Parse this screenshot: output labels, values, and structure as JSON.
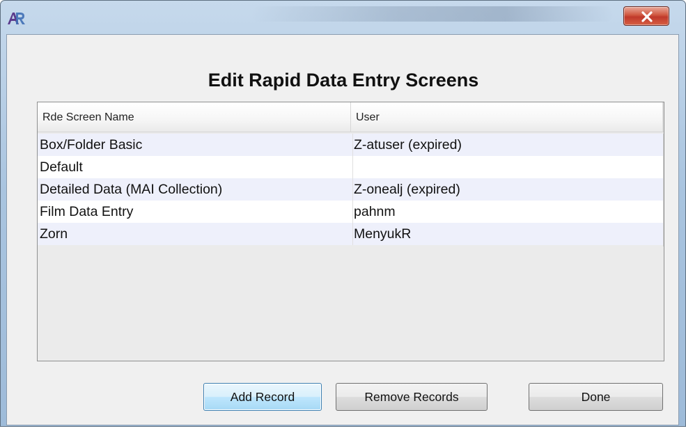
{
  "window": {
    "close_label": "X"
  },
  "dialog": {
    "heading": "Edit Rapid Data Entry Screens"
  },
  "table": {
    "columns": [
      "Rde Screen Name",
      "User"
    ],
    "rows": [
      [
        "Box/Folder Basic",
        "Z-atuser (expired)"
      ],
      [
        "Default",
        ""
      ],
      [
        "Detailed Data (MAI Collection)",
        "Z-onealj (expired)"
      ],
      [
        "Film Data Entry",
        "pahnm"
      ],
      [
        "Zorn",
        "MenyukR"
      ]
    ]
  },
  "buttons": {
    "add_label": "Add Record",
    "remove_label": "Remove Records",
    "done_label": "Done"
  },
  "icons": {
    "app": "app-logo-icon",
    "close": "close-icon"
  },
  "colors": {
    "title_bar": "#a9c4df",
    "close_button": "#c0392b",
    "row_stripe": "#eef0fb",
    "default_button_border": "#3c7fb1"
  }
}
